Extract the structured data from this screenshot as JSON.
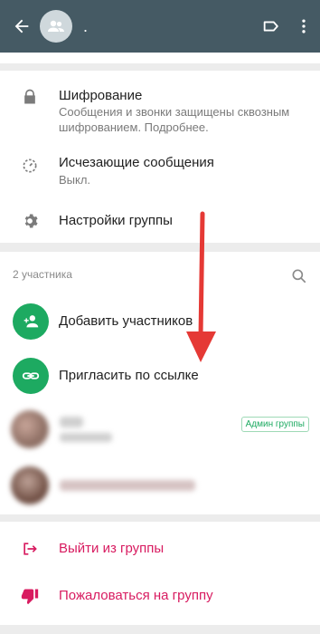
{
  "appbar": {
    "title": ".",
    "back_icon": "arrow-left-icon",
    "avatar_icon": "group-icon",
    "label_icon": "label-icon",
    "menu_icon": "more-vert-icon"
  },
  "settings": {
    "encryption": {
      "title": "Шифрование",
      "subtitle": "Сообщения и звонки защищены сквозным шифрованием. Подробнее.",
      "icon": "lock-icon"
    },
    "disappearing": {
      "title": "Исчезающие сообщения",
      "subtitle": "Выкл.",
      "icon": "timer-icon"
    },
    "group_settings": {
      "title": "Настройки группы",
      "icon": "gear-icon"
    }
  },
  "participants": {
    "count_label": "2 участника",
    "search_icon": "search-icon",
    "add_label": "Добавить участников",
    "invite_label": "Пригласить по ссылке",
    "admin_badge": "Админ группы"
  },
  "actions": {
    "exit_label": "Выйти из группы",
    "report_label": "Пожаловаться на группу"
  },
  "colors": {
    "appbar": "#455a64",
    "accent_green": "#1daa61",
    "danger": "#d81b60",
    "annotation_arrow": "#e53935"
  }
}
